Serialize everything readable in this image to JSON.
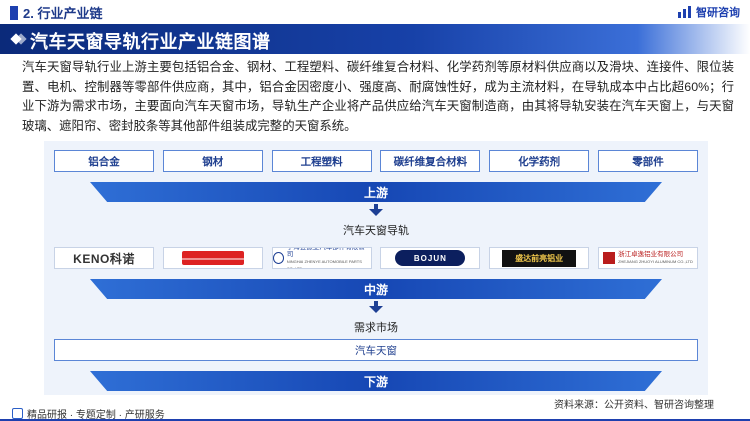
{
  "header": {
    "section_label": "2. 行业产业链",
    "brand_name": "智研咨询",
    "brand_icon": "bar-chart-icon"
  },
  "title": "汽车天窗导轨行业产业链图谱",
  "intro": "汽车天窗导轨行业上游主要包括铝合金、钢材、工程塑料、碳纤维复合材料、化学药剂等原材料供应商以及滑块、连接件、限位装置、电机、控制器等零部件供应商，其中，铝合金因密度小、强度高、耐腐蚀性好，成为主流材料，在导轨成本中占比超60%；行业下游为需求市场，主要面向汽车天窗市场，导轨生产企业将产品供应给汽车天窗制造商，由其将导轨安装在汽车天窗上，与天窗玻璃、遮阳帘、密封胶条等其他部件组装成完整的天窗系统。",
  "upstream": {
    "materials": [
      "铝合金",
      "钢材",
      "工程塑料",
      "碳纤维复合材料",
      "化学药剂",
      "零部件"
    ],
    "band_label": "上游"
  },
  "midstream": {
    "label": "汽车天窗导轨",
    "logos": [
      {
        "text": "KENO科诺",
        "icon": "keno-logo"
      },
      {
        "text": "",
        "icon": "red-brand-logo"
      },
      {
        "text": "宁海县振业汽车部件有限公司",
        "sub": "NINGHAI ZHENYE AUTOMOBILE PARTS CO.,LTD",
        "icon": "ningbo-circle-logo"
      },
      {
        "text": "BOJUN",
        "icon": "bojun-logo"
      },
      {
        "text": "盛达前亮铝业",
        "icon": "shengda-logo"
      },
      {
        "text": "浙江卓逸铝业有限公司",
        "sub": "ZHEJIANG ZHUOYI ALUMINUM CO.,LTD",
        "icon": "zhuoyi-logo"
      }
    ],
    "band_label": "中游"
  },
  "downstream": {
    "label": "需求市场",
    "market": "汽车天窗",
    "band_label": "下游"
  },
  "footer": {
    "left": "精品研报 · 专题定制 · 产研服务",
    "source": "资料来源：公开资料、智研咨询整理"
  },
  "colors": {
    "primary": "#1e40af",
    "band": "#1647b4",
    "panel": "#eef3fb"
  }
}
